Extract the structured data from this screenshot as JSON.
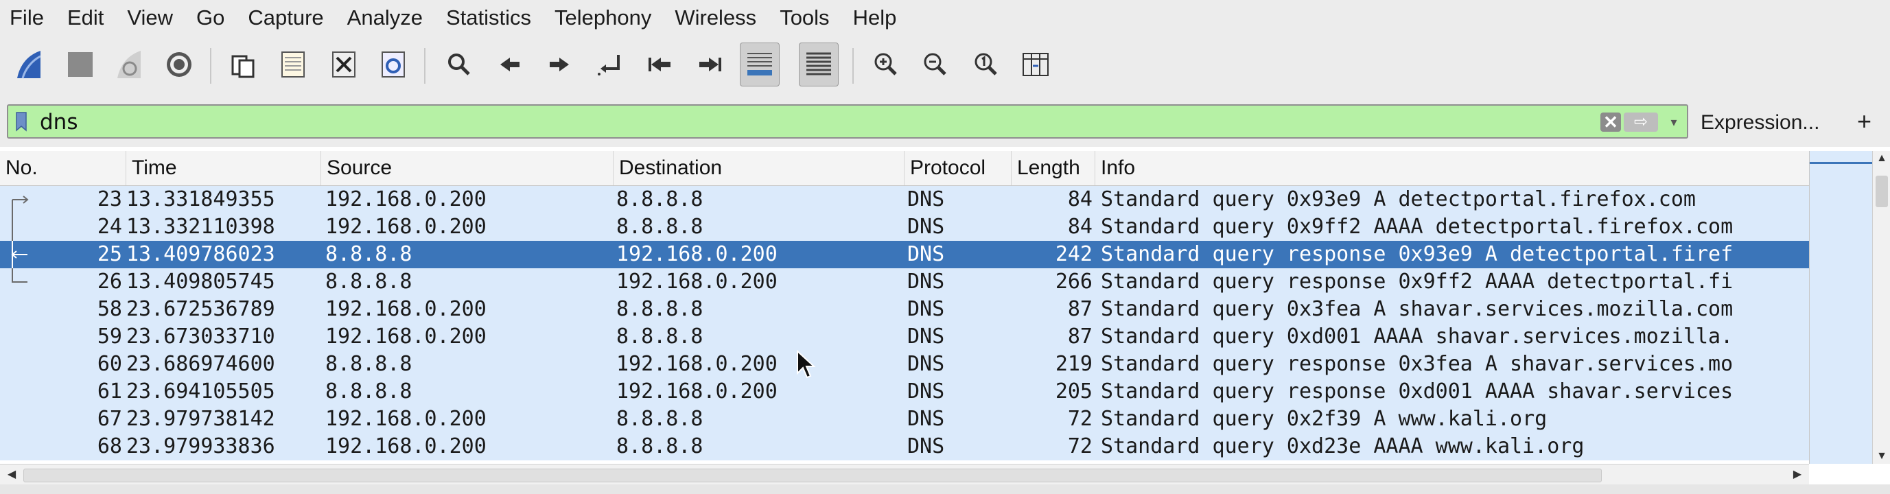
{
  "menu": [
    {
      "label": "File"
    },
    {
      "label": "Edit"
    },
    {
      "label": "View"
    },
    {
      "label": "Go"
    },
    {
      "label": "Capture"
    },
    {
      "label": "Analyze"
    },
    {
      "label": "Statistics"
    },
    {
      "label": "Telephony"
    },
    {
      "label": "Wireless"
    },
    {
      "label": "Tools"
    },
    {
      "label": "Help"
    }
  ],
  "toolbar": {
    "icons": [
      "start-capture-icon",
      "stop-capture-icon",
      "restart-capture-icon",
      "capture-options-icon",
      "open-file-icon",
      "save-file-icon",
      "close-file-icon",
      "reload-file-icon",
      "find-packet-icon",
      "go-back-icon",
      "go-forward-icon",
      "go-to-packet-icon",
      "first-packet-icon",
      "last-packet-icon",
      "autoscroll-icon",
      "colorize-icon",
      "zoom-in-icon",
      "zoom-out-icon",
      "normal-size-icon",
      "resize-columns-icon"
    ],
    "pressed": [
      "autoscroll-icon",
      "colorize-icon"
    ]
  },
  "filter": {
    "value": "dns",
    "expression_label": "Expression...",
    "add_label": "+",
    "clear_label": "✕",
    "apply_label": "⇨",
    "background": "#b6f1a5"
  },
  "columns": {
    "no": "No.",
    "time": "Time",
    "source": "Source",
    "destination": "Destination",
    "protocol": "Protocol",
    "length": "Length",
    "info": "Info"
  },
  "packets": [
    {
      "no": "23",
      "time": "13.331849355",
      "source": "192.168.0.200",
      "destination": "8.8.8.8",
      "protocol": "DNS",
      "length": "84",
      "info": "Standard query 0x93e9 A detectportal.firefox.com",
      "related": "request"
    },
    {
      "no": "24",
      "time": "13.332110398",
      "source": "192.168.0.200",
      "destination": "8.8.8.8",
      "protocol": "DNS",
      "length": "84",
      "info": "Standard query 0x9ff2 AAAA detectportal.firefox.com",
      "related": "line"
    },
    {
      "no": "25",
      "time": "13.409786023",
      "source": "8.8.8.8",
      "destination": "192.168.0.200",
      "protocol": "DNS",
      "length": "242",
      "info": "Standard query response 0x93e9 A detectportal.firef",
      "related": "response",
      "selected": true
    },
    {
      "no": "26",
      "time": "13.409805745",
      "source": "8.8.8.8",
      "destination": "192.168.0.200",
      "protocol": "DNS",
      "length": "266",
      "info": "Standard query response 0x9ff2 AAAA detectportal.fi",
      "related": "end"
    },
    {
      "no": "58",
      "time": "23.672536789",
      "source": "192.168.0.200",
      "destination": "8.8.8.8",
      "protocol": "DNS",
      "length": "87",
      "info": "Standard query 0x3fea A shavar.services.mozilla.com"
    },
    {
      "no": "59",
      "time": "23.673033710",
      "source": "192.168.0.200",
      "destination": "8.8.8.8",
      "protocol": "DNS",
      "length": "87",
      "info": "Standard query 0xd001 AAAA shavar.services.mozilla."
    },
    {
      "no": "60",
      "time": "23.686974600",
      "source": "8.8.8.8",
      "destination": "192.168.0.200",
      "protocol": "DNS",
      "length": "219",
      "info": "Standard query response 0x3fea A shavar.services.mo"
    },
    {
      "no": "61",
      "time": "23.694105505",
      "source": "8.8.8.8",
      "destination": "192.168.0.200",
      "protocol": "DNS",
      "length": "205",
      "info": "Standard query response 0xd001 AAAA shavar.services"
    },
    {
      "no": "67",
      "time": "23.979738142",
      "source": "192.168.0.200",
      "destination": "8.8.8.8",
      "protocol": "DNS",
      "length": "72",
      "info": "Standard query 0x2f39 A www.kali.org"
    },
    {
      "no": "68",
      "time": "23.979933836",
      "source": "192.168.0.200",
      "destination": "8.8.8.8",
      "protocol": "DNS",
      "length": "72",
      "info": "Standard query 0xd23e AAAA www.kali.org"
    }
  ],
  "colors": {
    "row_bg": "#dbeafb",
    "selected_bg": "#3b75b9",
    "selected_fg": "#ffffff"
  }
}
